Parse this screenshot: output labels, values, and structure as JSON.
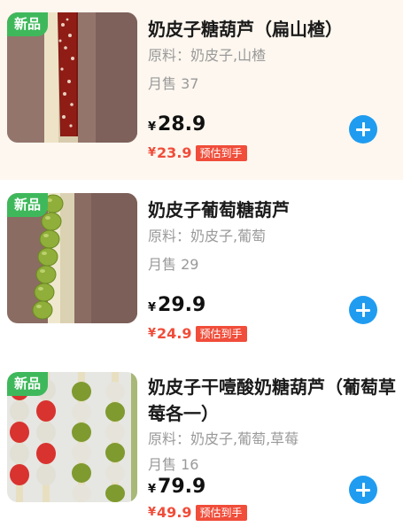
{
  "products": [
    {
      "badge": "新品",
      "title": "奶皮子糖葫芦（扁山楂）",
      "ingredients": "原料：奶皮子,山楂",
      "sales": "月售 37",
      "currency": "¥",
      "price": "28.9",
      "promo_price": "23.9",
      "promo_tag": "预估到手",
      "image": "hawthorn-skewer-photo"
    },
    {
      "badge": "新品",
      "title": "奶皮子葡萄糖葫芦",
      "ingredients": "原料：奶皮子,葡萄",
      "sales": "月售 29",
      "currency": "¥",
      "price": "29.9",
      "promo_price": "24.9",
      "promo_tag": "预估到手",
      "image": "grape-skewer-photo"
    },
    {
      "badge": "新品",
      "title": "奶皮子干噎酸奶糖葫芦（葡萄草莓各一）",
      "ingredients": "原料：奶皮子,葡萄,草莓",
      "sales": "月售 16",
      "currency": "¥",
      "price": "79.9",
      "promo_price": "49.9",
      "promo_tag": "预估到手",
      "image": "strawberry-grape-skewers-photo"
    }
  ],
  "colors": {
    "badge_green": "#3fb85b",
    "promo_red": "#f04d3a",
    "add_blue": "#1f9cf0",
    "highlight_bg": "#fdf7ef"
  },
  "icons": {
    "add": "plus-circle-icon"
  }
}
